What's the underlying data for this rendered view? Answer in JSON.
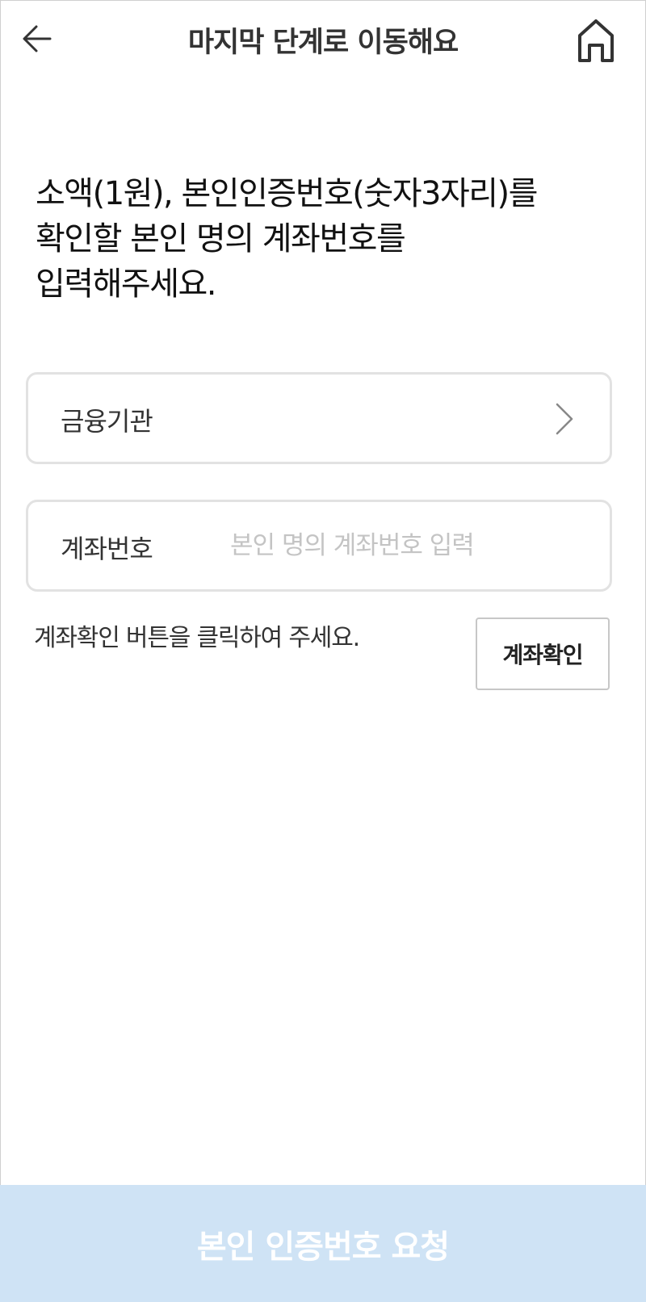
{
  "header": {
    "title": "마지막 단계로 이동해요",
    "back_icon": "arrow-left-icon",
    "home_icon": "home-icon"
  },
  "instruction": "소액(1원), 본인인증번호(숫자3자리)를\n확인할 본인 명의 계좌번호를\n입력해주세요.",
  "institution_field": {
    "label": "금융기관",
    "icon": "chevron-right-icon"
  },
  "account_field": {
    "label": "계좌번호",
    "value": "",
    "placeholder": "본인 명의 계좌번호 입력"
  },
  "hint": "계좌확인 버튼을 클릭하여 주세요.",
  "verify_button": "계좌확인",
  "request_button": "본인 인증번호 요청",
  "colors": {
    "request_button_bg": "#cfe3f5",
    "field_border": "#e2e2e2",
    "placeholder": "#c4c4c4"
  }
}
